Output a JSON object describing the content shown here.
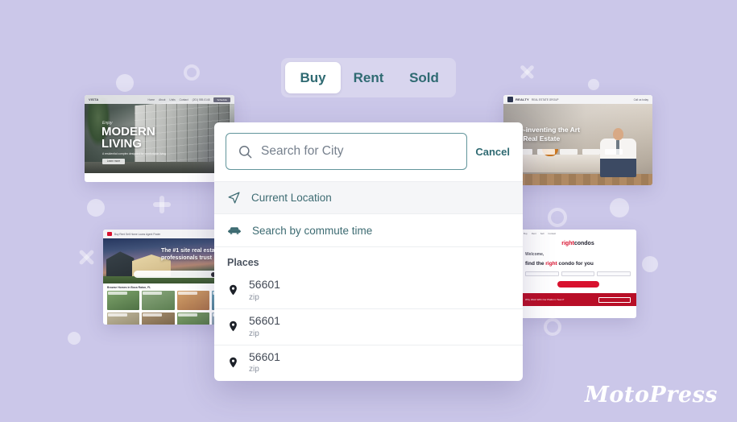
{
  "background": {
    "color": "#cbc7e9",
    "decor_note": "white translucent circles, rings, plus and cross shapes"
  },
  "tabs": {
    "items": [
      {
        "label": "Buy",
        "active": true
      },
      {
        "label": "Rent",
        "active": false
      },
      {
        "label": "Sold",
        "active": false
      }
    ],
    "active_bg": "#ffffff",
    "track_bg": "#d8d5ee",
    "text_color": "#2f6a72"
  },
  "search": {
    "placeholder": "Search for City",
    "value": "",
    "icon": "search-icon",
    "border_color": "#62959b",
    "cancel_label": "Cancel"
  },
  "suggestions": [
    {
      "label": "Current Location",
      "icon": "navigation-arrow-icon",
      "highlighted": true
    },
    {
      "label": "Search by commute time",
      "icon": "car-icon",
      "highlighted": false
    }
  ],
  "places": {
    "header": "Places",
    "items": [
      {
        "zip": "56601",
        "kind": "zip",
        "icon": "map-pin-icon"
      },
      {
        "zip": "56601",
        "kind": "zip",
        "icon": "map-pin-icon"
      },
      {
        "zip": "56601",
        "kind": "zip",
        "icon": "map-pin-icon"
      }
    ]
  },
  "thumbnails": {
    "modern": {
      "logo": "VISTA",
      "nav": [
        "Home",
        "About",
        "Units",
        "Contact"
      ],
      "phone": "(201) 555-0148",
      "cta": "Schedule",
      "eyebrow": "Enjoy",
      "title_line1": "MODERN",
      "title_line2": "LIVING",
      "subtitle": "A residential complex designed for comfortable living",
      "button": "Learn more"
    },
    "art": {
      "logo": "REALTY",
      "logo_sub": "REAL ESTATE GROUP",
      "contact": "Call us today",
      "headline_line1": "Re-inventing the Art",
      "headline_line2": "of Real Estate"
    },
    "trust": {
      "nav_note": "Buy  Rent  Sell  Home Loans  Agent Finder",
      "headline_line1": "The #1 site real estate",
      "headline_line2": "professionals trust",
      "search_placeholder": "Address, School, City, Zip or Neighborhood",
      "grid_label": "Browse Homes in Boca Raton, FL"
    },
    "condos": {
      "nav": [
        "Buy",
        "Rent",
        "Sell",
        "Contact"
      ],
      "logo_accent": "right",
      "logo_rest": "condos",
      "headline_pre": "Welcome,",
      "headline_line": "find the right condo for you",
      "cta": "Start your search",
      "band_text": "Why Work With Our Platform Team?",
      "band_button": "Learn more"
    }
  },
  "branding": {
    "wordmark": "MotoPress",
    "color": "#ffffff"
  }
}
